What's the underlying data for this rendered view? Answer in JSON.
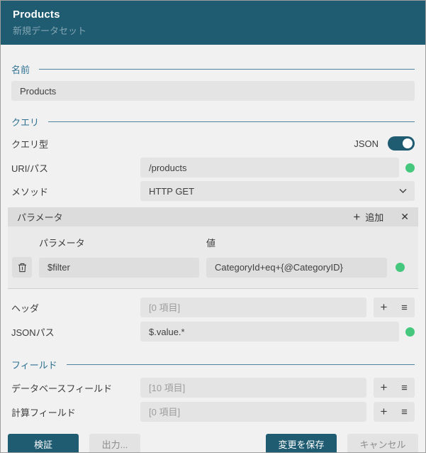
{
  "header": {
    "title": "Products",
    "subtitle": "新規データセット"
  },
  "sections": {
    "name": {
      "label": "名前",
      "value": "Products"
    },
    "query": {
      "label": "クエリ",
      "query_type": {
        "label": "クエリ型",
        "value": "JSON",
        "state": "on"
      },
      "uri": {
        "label": "URI/パス",
        "value": "/products"
      },
      "method": {
        "label": "メソッド",
        "value": "HTTP GET"
      },
      "parameters": {
        "label": "パラメータ",
        "add_label": "追加",
        "columns": {
          "name": "パラメータ",
          "value": "値"
        },
        "rows": [
          {
            "name": "$filter",
            "value": "CategoryId+eq+{@CategoryID}"
          }
        ]
      },
      "headers": {
        "label": "ヘッダ",
        "placeholder": "[0 項目]"
      },
      "json_path": {
        "label": "JSONパス",
        "value": "$.value.*"
      }
    },
    "fields": {
      "label": "フィールド",
      "database_fields": {
        "label": "データベースフィールド",
        "placeholder": "[10 項目]"
      },
      "calculated_fields": {
        "label": "計算フィールド",
        "placeholder": "[0 項目]"
      }
    }
  },
  "footer": {
    "validate": "検証",
    "output": "出力...",
    "save": "変更を保存",
    "cancel": "キャンセル"
  },
  "icons": {
    "add": "+",
    "close": "✕",
    "menu": "≡"
  },
  "colors": {
    "accent": "#1f5c72",
    "section": "#2e7191",
    "valid": "#45c87e"
  }
}
